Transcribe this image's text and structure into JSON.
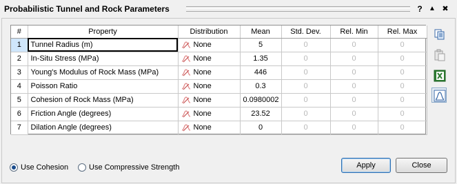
{
  "window": {
    "title": "Probabilistic Tunnel and Rock Parameters",
    "help_label": "?",
    "collapse_label": "▲",
    "close_label": "✖"
  },
  "grid": {
    "headers": [
      "#",
      "Property",
      "Distribution",
      "Mean",
      "Std. Dev.",
      "Rel. Min",
      "Rel. Max"
    ],
    "rows": [
      {
        "num": "1",
        "property": "Tunnel Radius (m)",
        "distribution": "None",
        "mean": "5",
        "std_dev": "0",
        "rel_min": "0",
        "rel_max": "0"
      },
      {
        "num": "2",
        "property": "In-Situ Stress (MPa)",
        "distribution": "None",
        "mean": "1.35",
        "std_dev": "0",
        "rel_min": "0",
        "rel_max": "0"
      },
      {
        "num": "3",
        "property": "Young's Modulus of Rock Mass (MPa)",
        "distribution": "None",
        "mean": "446",
        "std_dev": "0",
        "rel_min": "0",
        "rel_max": "0"
      },
      {
        "num": "4",
        "property": "Poisson Ratio",
        "distribution": "None",
        "mean": "0.3",
        "std_dev": "0",
        "rel_min": "0",
        "rel_max": "0"
      },
      {
        "num": "5",
        "property": "Cohesion of Rock Mass (MPa)",
        "distribution": "None",
        "mean": "0.0980002",
        "std_dev": "0",
        "rel_min": "0",
        "rel_max": "0"
      },
      {
        "num": "6",
        "property": "Friction Angle (degrees)",
        "distribution": "None",
        "mean": "23.52",
        "std_dev": "0",
        "rel_min": "0",
        "rel_max": "0"
      },
      {
        "num": "7",
        "property": "Dilation Angle (degrees)",
        "distribution": "None",
        "mean": "0",
        "std_dev": "0",
        "rel_min": "0",
        "rel_max": "0"
      }
    ]
  },
  "sidebar": {
    "icons": [
      "copy-icon",
      "paste-icon",
      "excel-export-icon",
      "distribution-chart-icon"
    ]
  },
  "options": {
    "use_cohesion": "Use Cohesion",
    "use_compressive_strength": "Use Compressive Strength",
    "selected": "use_cohesion"
  },
  "buttons": {
    "apply": "Apply",
    "close": "Close"
  },
  "colors": {
    "selection": "#cfe6fb",
    "disabled_text": "#b8b8b8",
    "accent": "#2f6fb0"
  }
}
